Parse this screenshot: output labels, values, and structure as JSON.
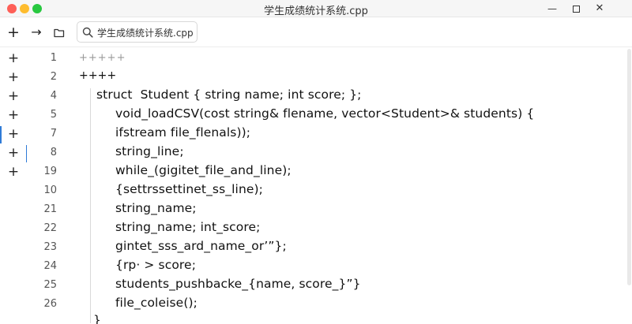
{
  "window": {
    "title": "学生成绩统计系统.cpp",
    "minimize_glyph": "—",
    "close_glyph": "✕"
  },
  "toolbar": {
    "add_glyph": "+",
    "forward_glyph": "→",
    "search_value": "学生成绩统计系统.cpp"
  },
  "sidebar": {
    "markers": [
      "+",
      "+",
      "+",
      "+",
      "+",
      "+",
      "+"
    ]
  },
  "editor": {
    "lines": [
      {
        "num": "1",
        "text": "+++++"
      },
      {
        "num": "2",
        "text": "++++"
      },
      {
        "num": "4",
        "text": "struct  Student { string name; int score; };"
      },
      {
        "num": "5",
        "text": "void_loadCSV(cost string& flename, vector<Student>& students) {"
      },
      {
        "num": "7",
        "text": "ifstream file_flenals));"
      },
      {
        "num": "8",
        "text": "string_line;"
      },
      {
        "num": "19",
        "text": "while_(gigitet_file_and_line);"
      },
      {
        "num": "10",
        "text": "{settrssettinet_ss_line);"
      },
      {
        "num": "21",
        "text": "string_name;"
      },
      {
        "num": "22",
        "text": "string_name; int_score;"
      },
      {
        "num": "23",
        "text": "gintet_sss_ard_name_or’”};"
      },
      {
        "num": "24",
        "text": "{rp· > score;"
      },
      {
        "num": "25",
        "text": "students_pushbacke_{name, score_}”}"
      },
      {
        "num": "26",
        "text": "file_coleise();"
      },
      {
        "num": "",
        "text": "}"
      }
    ]
  },
  "colors": {
    "accent": "#2f7bd7",
    "traffic_red": "#fe5f57",
    "traffic_yellow": "#febc2e",
    "traffic_green": "#28c840"
  }
}
